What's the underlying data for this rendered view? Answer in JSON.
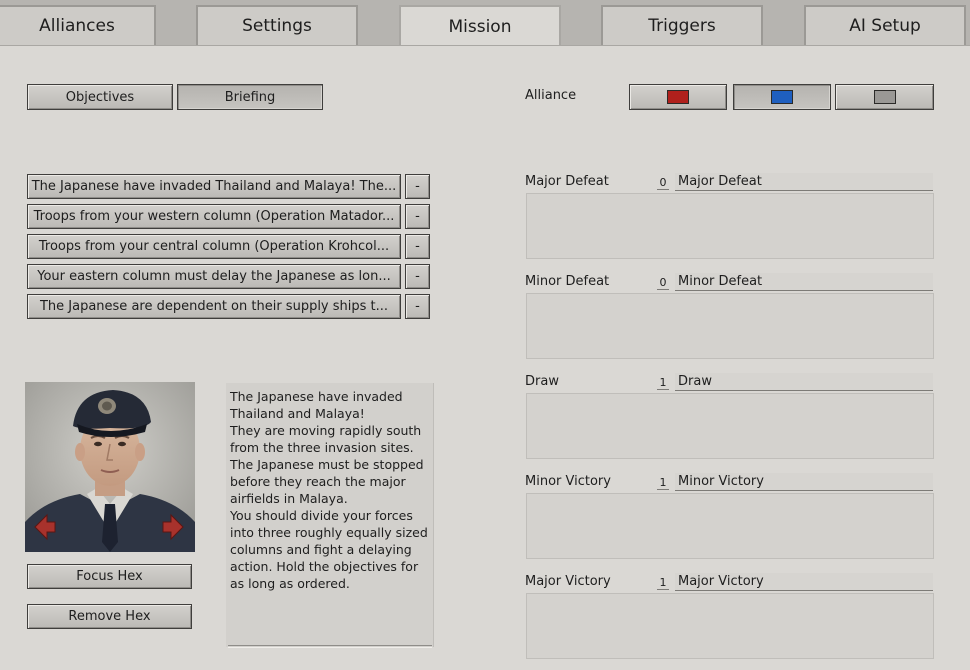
{
  "tabs": [
    {
      "label": "Alliances"
    },
    {
      "label": "Settings"
    },
    {
      "label": "Mission"
    },
    {
      "label": "Triggers"
    },
    {
      "label": "AI Setup"
    }
  ],
  "mode_buttons": {
    "objectives": "Objectives",
    "briefing": "Briefing"
  },
  "alliance": {
    "label": "Alliance",
    "colors": [
      "#b0201c",
      "#1f5fbf",
      "#9a9895"
    ]
  },
  "briefing_items": [
    {
      "text": "The Japanese have invaded Thailand and Malaya! The...",
      "remove": "-"
    },
    {
      "text": "Troops from your western column (Operation Matador...",
      "remove": "-"
    },
    {
      "text": "Troops from your central column (Operation Krohcol...",
      "remove": "-"
    },
    {
      "text": "Your eastern column must delay the Japanese as lon...",
      "remove": "-"
    },
    {
      "text": "The Japanese are dependent on their supply ships t...",
      "remove": "-"
    }
  ],
  "briefing_text": "The Japanese have invaded Thailand and Malaya!\nThey are moving rapidly south from the three invasion sites. The Japanese must be stopped before they reach the major airfields in Malaya.\nYou should divide your forces into three roughly equally sized columns and fight a delaying action. Hold the objectives for as long as ordered.",
  "hex_buttons": {
    "focus": "Focus Hex",
    "remove": "Remove Hex"
  },
  "conditions": [
    {
      "label": "Major Defeat",
      "value": "0",
      "name": "Major Defeat"
    },
    {
      "label": "Minor Defeat",
      "value": "0",
      "name": "Minor Defeat"
    },
    {
      "label": "Draw",
      "value": "1",
      "name": "Draw"
    },
    {
      "label": "Minor Victory",
      "value": "1",
      "name": "Minor Victory"
    },
    {
      "label": "Major Victory",
      "value": "1",
      "name": "Major Victory"
    }
  ],
  "colors": {
    "accent_red": "#a8322c",
    "panel": "#dad8d4"
  },
  "icons": {
    "prev": "arrow-left-icon",
    "next": "arrow-right-icon"
  }
}
